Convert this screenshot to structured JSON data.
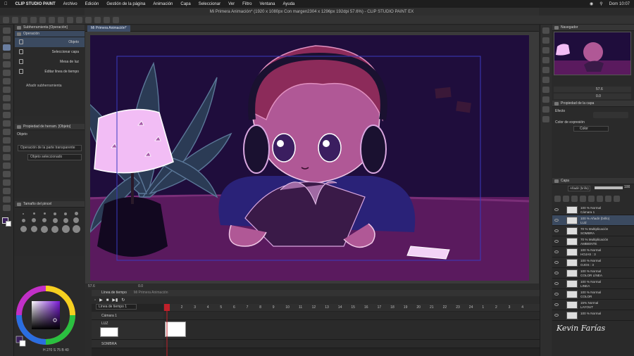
{
  "menubar": {
    "app": "CLIP STUDIO PAINT",
    "items": [
      "Archivo",
      "Edición",
      "Gestión de la página",
      "Animación",
      "Capa",
      "Seleccionar",
      "Ver",
      "Filtro",
      "Ventana",
      "Ayuda"
    ],
    "clock": "Dom 10:07"
  },
  "window": {
    "title": "Mi Primera Animación* (1920 x 1080px Con margen2304 x 1296px 192dpi 57.6%) - CLIP STUDIO PAINT EX",
    "canvas_tab": "Mi Primera Animación*"
  },
  "subtool": {
    "header": "Subherramienta [Operación]",
    "group": "Operación",
    "items": [
      "Objeto",
      "Seleccionar capa",
      "Mesa de luz",
      "Editar línea de tiempo"
    ],
    "add": "Añadir subherramienta"
  },
  "toolprop": {
    "header": "Propiedad de herram. [Objeto]",
    "label": "Objeto",
    "field1": "Operación de la parte transparente",
    "field2": "Objeto seleccionado"
  },
  "brushsize": {
    "header": "Tamaño del pincel"
  },
  "colorwheel": {
    "readout": "H 270  S 75  B 40"
  },
  "canvas_status": {
    "zoom": "57.6",
    "angle": "0.0"
  },
  "timeline": {
    "header": "Línea de tiempo",
    "header_tab2": "Mi Primera Animación",
    "selector": "Línea de tiempo 1",
    "frames": [
      "1",
      "2",
      "3",
      "4",
      "5",
      "6",
      "7",
      "8",
      "9",
      "10",
      "11",
      "12",
      "13",
      "14",
      "15",
      "16",
      "17",
      "18",
      "19",
      "20",
      "21",
      "22",
      "23",
      "24",
      "1",
      "2",
      "3",
      "4"
    ],
    "tracks": [
      {
        "label": "Cámara 1"
      },
      {
        "label": "LUZ"
      },
      {
        "label": "SOMBRA"
      }
    ],
    "current_frame": "1"
  },
  "navigator": {
    "header": "Navegador",
    "zoom": "57.6",
    "angle": "0.0"
  },
  "layer_prop": {
    "header": "Propiedad de la capa",
    "effect": "Efecto",
    "expr": "Color de expresión",
    "expr_value": "Color"
  },
  "layers_panel": {
    "header": "Capa",
    "blend": "Añadir (brillo)",
    "opacity": "100"
  },
  "layers": [
    {
      "l1": "100 % Normal",
      "l2": "Cámara 1",
      "selected": false
    },
    {
      "l1": "100 % Añadir (brillo)",
      "l2": "LUZ",
      "selected": true
    },
    {
      "l1": "70 % Multiplicación",
      "l2": "SOMBRA",
      "selected": false
    },
    {
      "l1": "70 % Multiplicación",
      "l2": "AMBIENTE",
      "selected": false
    },
    {
      "l1": "100 % Normal",
      "l2": "HOJAS : 3",
      "selected": false
    },
    {
      "l1": "100 % Normal",
      "l2": "OJOS : 3",
      "selected": false
    },
    {
      "l1": "100 % Normal",
      "l2": "COLOR LÍNEA",
      "selected": false
    },
    {
      "l1": "100 % Normal",
      "l2": "LINEA",
      "selected": false
    },
    {
      "l1": "100 % Normal",
      "l2": "COLOR",
      "selected": false
    },
    {
      "l1": "15% Normal",
      "l2": "LAYOUT",
      "selected": false
    },
    {
      "l1": "100 % Normal",
      "l2": "",
      "selected": false
    }
  ],
  "signature": "Kevin Farías",
  "colors": {
    "accent": "#3b4a60",
    "paper": "#5a1a5e",
    "night": "#1f0d3c"
  }
}
